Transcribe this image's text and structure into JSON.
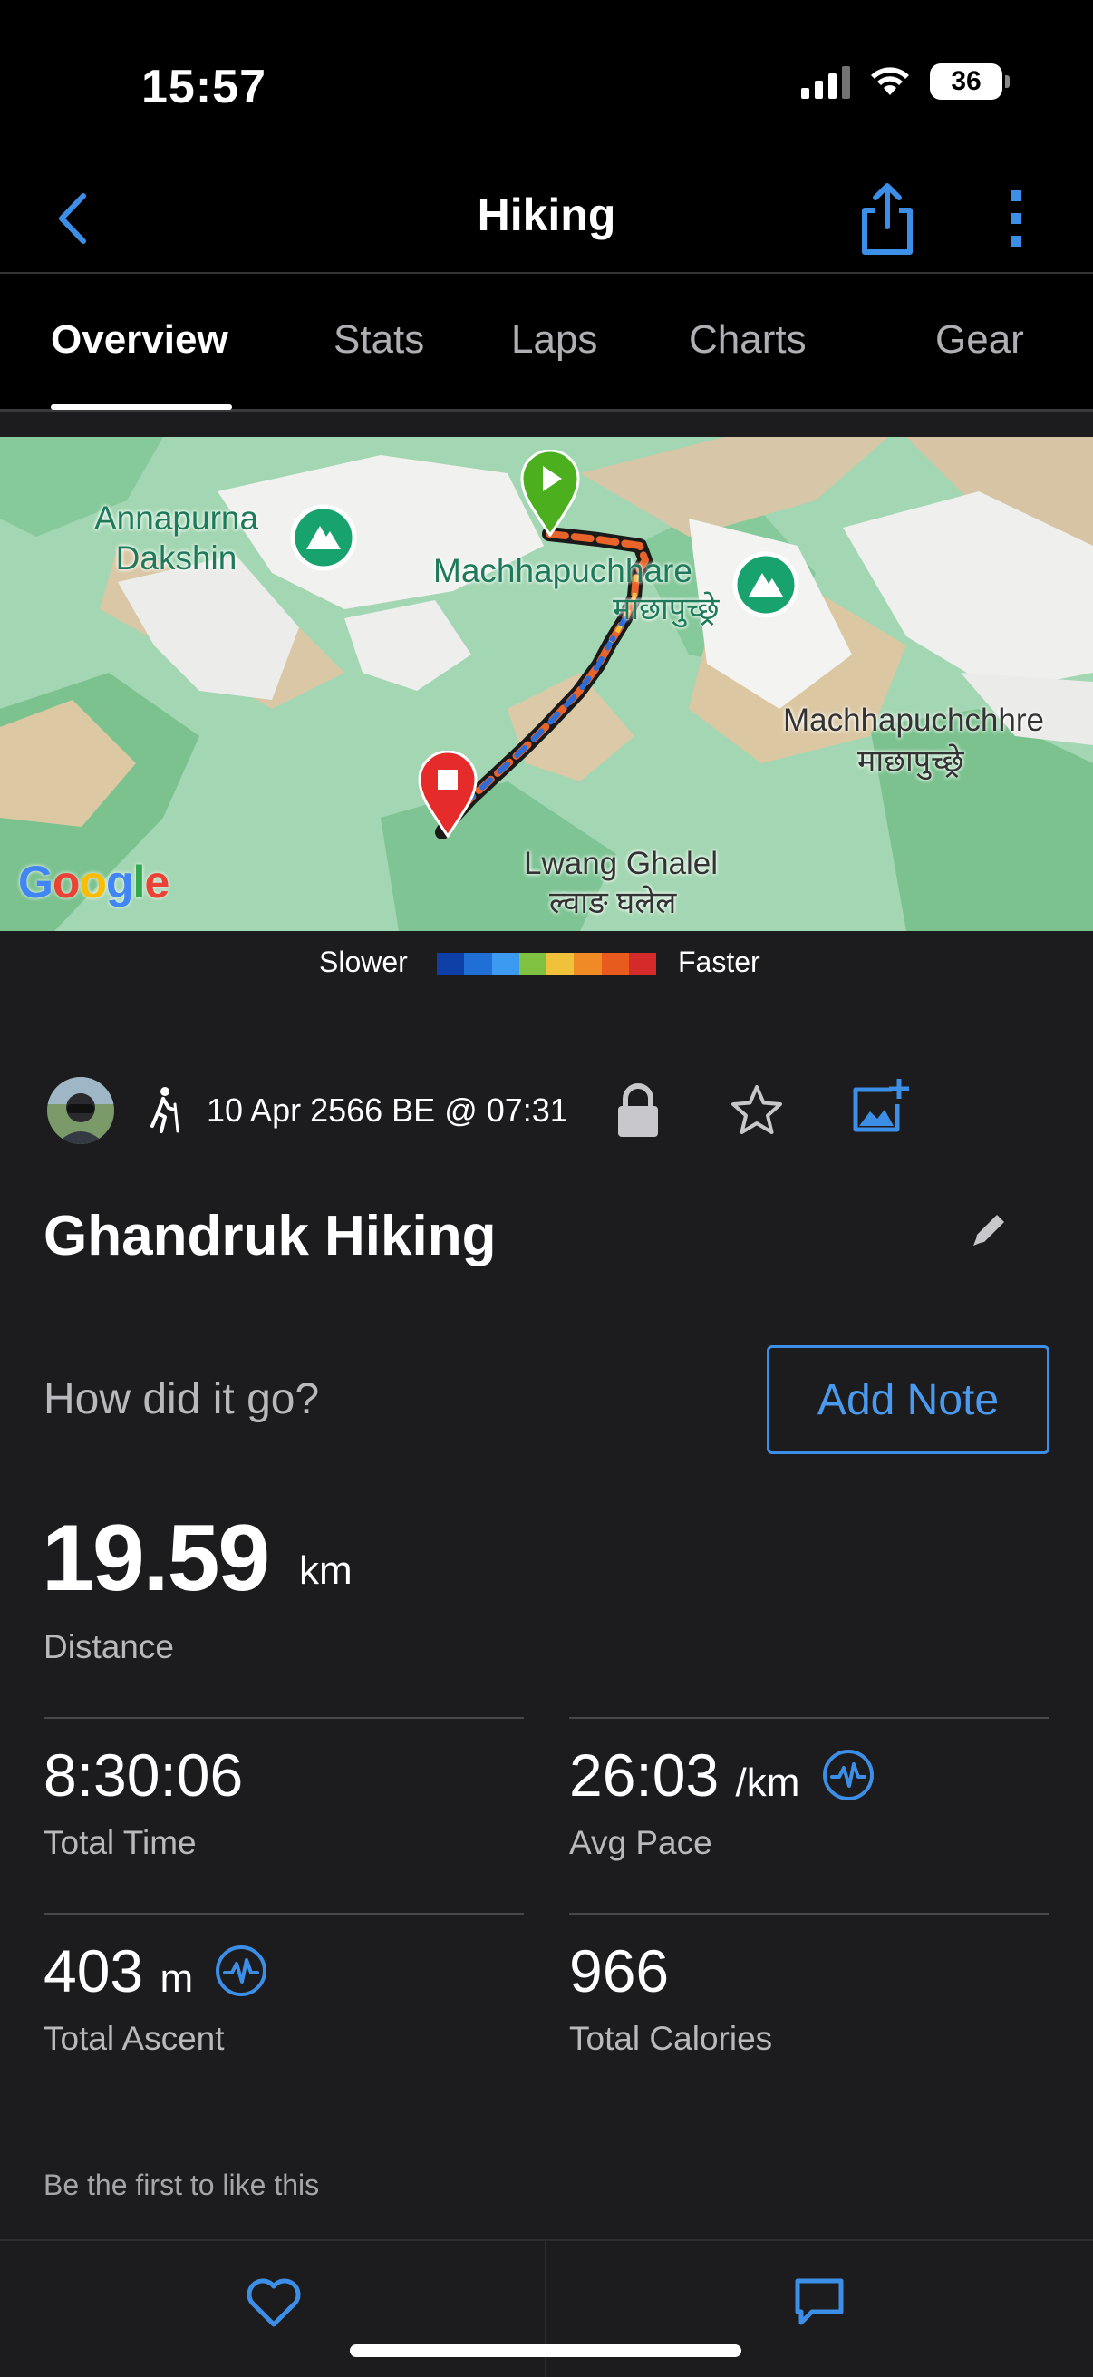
{
  "status_bar": {
    "time": "15:57",
    "battery": "36"
  },
  "nav": {
    "title": "Hiking",
    "icons": [
      "back-chevron-icon",
      "share-icon",
      "more-vertical-icon"
    ]
  },
  "tabs": [
    {
      "label": "Overview",
      "active": true
    },
    {
      "label": "Stats",
      "active": false
    },
    {
      "label": "Laps",
      "active": false
    },
    {
      "label": "Charts",
      "active": false
    },
    {
      "label": "Gear",
      "active": false
    }
  ],
  "map": {
    "labels": {
      "annapurna": "Annapurna\nDakshin",
      "machhapuchhare": "Machhapuchhare",
      "machhapuchhare_np": "माछापुच्छ्रे",
      "machhapuchchhre": "Machhapuchchhre",
      "machhapuchchhre_np": "माछापुच्छ्रे",
      "lwang": "Lwang Ghalel",
      "lwang_np": "ल्वाङ घलेल"
    },
    "attribution": "Google"
  },
  "legend": {
    "slower": "Slower",
    "faster": "Faster",
    "colors": [
      "#0d3fa6",
      "#1f6fd6",
      "#3c9bf0",
      "#7fc242",
      "#f0c23c",
      "#f08a24",
      "#e85a1e",
      "#d42a2a"
    ]
  },
  "activity": {
    "date": "10 Apr 2566 BE @ 07:31",
    "title": "Ghandruk Hiking",
    "note_prompt": "How did it go?",
    "add_note": "Add Note"
  },
  "stats": {
    "distance": {
      "value": "19.59",
      "unit": "km",
      "label": "Distance"
    },
    "total_time": {
      "value": "8:30:06",
      "label": "Total Time"
    },
    "avg_pace": {
      "value": "26:03",
      "unit": "/km",
      "label": "Avg Pace"
    },
    "total_ascent": {
      "value": "403",
      "unit": "m",
      "label": "Total Ascent"
    },
    "total_calories": {
      "value": "966",
      "label": "Total Calories"
    }
  },
  "social": {
    "like_text": "Be the first to like this"
  },
  "colors": {
    "accent": "#3d8ee6",
    "background": "#1c1c1e",
    "start_pin": "#4caf1e",
    "end_pin": "#e62b2b"
  }
}
